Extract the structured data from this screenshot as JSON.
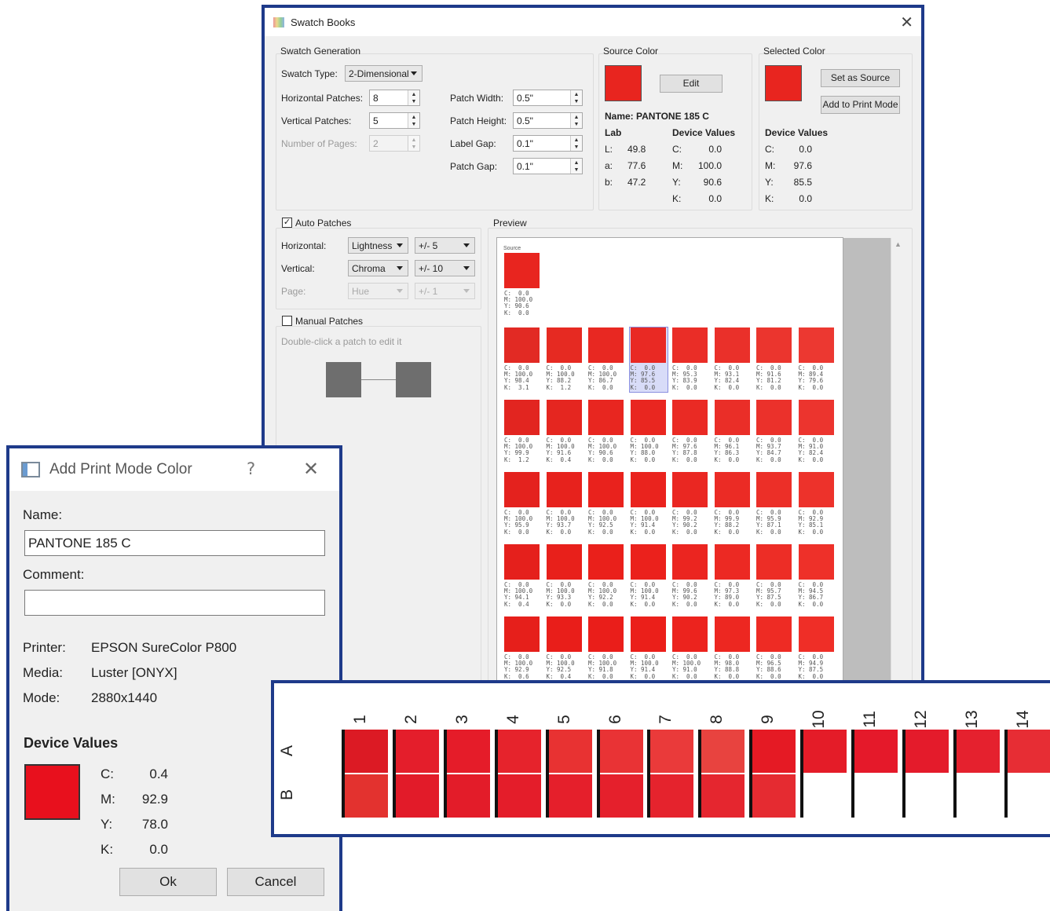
{
  "swatch_window": {
    "title": "Swatch Books",
    "generation": {
      "title": "Swatch Generation",
      "swatch_type_label": "Swatch Type:",
      "swatch_type_value": "2-Dimensional",
      "horizontal_label": "Horizontal Patches:",
      "horizontal_value": "8",
      "vertical_label": "Vertical Patches:",
      "vertical_value": "5",
      "pages_label": "Number of Pages:",
      "pages_value": "2",
      "patch_width_label": "Patch Width:",
      "patch_width_value": "0.5\"",
      "patch_height_label": "Patch Height:",
      "patch_height_value": "0.5\"",
      "label_gap_label": "Label Gap:",
      "label_gap_value": "0.1\"",
      "patch_gap_label": "Patch Gap:",
      "patch_gap_value": "0.1\""
    },
    "source": {
      "title": "Source Color",
      "edit_label": "Edit",
      "name_line": "Name: PANTONE 185 C",
      "lab_header": "Lab",
      "device_header": "Device Values",
      "lab_rows": [
        [
          "L:",
          "49.8"
        ],
        [
          "a:",
          "77.6"
        ],
        [
          "b:",
          "47.2"
        ]
      ],
      "device_rows": [
        [
          "C:",
          "0.0"
        ],
        [
          "M:",
          "100.0"
        ],
        [
          "Y:",
          "90.6"
        ],
        [
          "K:",
          "0.0"
        ]
      ],
      "swatch_color": "#e8251f"
    },
    "selected": {
      "title": "Selected Color",
      "set_source_label": "Set as Source",
      "add_print_label": "Add to Print Mode",
      "device_header": "Device Values",
      "device_rows": [
        [
          "C:",
          "0.0"
        ],
        [
          "M:",
          "97.6"
        ],
        [
          "Y:",
          "85.5"
        ],
        [
          "K:",
          "0.0"
        ]
      ],
      "swatch_color": "#e8251f"
    },
    "auto": {
      "title": "Auto Patches",
      "checked": true,
      "horizontal_label": "Horizontal:",
      "horizontal_mode": "Lightness",
      "horizontal_step": "+/- 5",
      "vertical_label": "Vertical:",
      "vertical_mode": "Chroma",
      "vertical_step": "+/- 10",
      "page_label": "Page:",
      "page_mode": "Hue",
      "page_step": "+/- 1"
    },
    "manual": {
      "title": "Manual Patches",
      "checked": false,
      "hint": "Double-click a patch to edit it"
    },
    "preview": {
      "title": "Preview",
      "source_label": "Source",
      "source_values": "C:  0.0\nM: 100.0\nY: 90.6\nK:  0.0",
      "rows": [
        [
          {
            "c": "#e22a24",
            "t": "C:  0.0\nM: 100.0\nY: 98.4\nK:  3.1"
          },
          {
            "c": "#e62a22",
            "t": "C:  0.0\nM: 100.0\nY: 88.2\nK:  1.2"
          },
          {
            "c": "#e82822",
            "t": "C:  0.0\nM: 100.0\nY: 86.7\nK:  0.0"
          },
          {
            "c": "#e92924",
            "t": "C:  0.0\nM: 97.6\nY: 85.5\nK:  0.0",
            "sel": true
          },
          {
            "c": "#ea2d27",
            "t": "C:  0.0\nM: 95.3\nY: 83.9\nK:  0.0"
          },
          {
            "c": "#ea302a",
            "t": "C:  0.0\nM: 93.1\nY: 82.4\nK:  0.0"
          },
          {
            "c": "#eb352e",
            "t": "C:  0.0\nM: 91.6\nY: 81.2\nK:  0.0"
          },
          {
            "c": "#ec3831",
            "t": "C:  0.0\nM: 89.4\nY: 79.6\nK:  0.0"
          }
        ],
        [
          {
            "c": "#e22520",
            "t": "C:  0.0\nM: 100.0\nY: 99.9\nK:  1.2"
          },
          {
            "c": "#e52620",
            "t": "C:  0.0\nM: 100.0\nY: 91.6\nK:  0.4"
          },
          {
            "c": "#e82620",
            "t": "C:  0.0\nM: 100.0\nY: 90.6\nK:  0.0"
          },
          {
            "c": "#e92620",
            "t": "C:  0.0\nM: 100.0\nY: 88.0\nK:  0.0"
          },
          {
            "c": "#ea2a24",
            "t": "C:  0.0\nM: 97.6\nY: 87.8\nK:  0.0"
          },
          {
            "c": "#ea2e28",
            "t": "C:  0.0\nM: 96.1\nY: 86.3\nK:  0.0"
          },
          {
            "c": "#eb312b",
            "t": "C:  0.0\nM: 93.7\nY: 84.7\nK:  0.0"
          },
          {
            "c": "#ec342e",
            "t": "C:  0.0\nM: 91.0\nY: 82.4\nK:  0.0"
          }
        ],
        [
          {
            "c": "#e4221e",
            "t": "C:  0.0\nM: 100.0\nY: 95.9\nK:  0.0"
          },
          {
            "c": "#e7221d",
            "t": "C:  0.0\nM: 100.0\nY: 93.7\nK:  0.0"
          },
          {
            "c": "#e9221d",
            "t": "C:  0.0\nM: 100.0\nY: 92.5\nK:  0.0"
          },
          {
            "c": "#ea231e",
            "t": "C:  0.0\nM: 100.0\nY: 91.4\nK:  0.0"
          },
          {
            "c": "#ea2722",
            "t": "C:  0.0\nM: 99.2\nY: 90.2\nK:  0.0"
          },
          {
            "c": "#eb2b25",
            "t": "C:  0.0\nM: 99.9\nY: 88.2\nK:  0.0"
          },
          {
            "c": "#ec2f28",
            "t": "C:  0.0\nM: 95.9\nY: 87.1\nK:  0.0"
          },
          {
            "c": "#ed322b",
            "t": "C:  0.0\nM: 92.9\nY: 85.1\nK:  0.0"
          }
        ],
        [
          {
            "c": "#e5201c",
            "t": "C:  0.0\nM: 100.0\nY: 94.1\nK:  0.4"
          },
          {
            "c": "#e8201b",
            "t": "C:  0.0\nM: 100.0\nY: 93.3\nK:  0.0"
          },
          {
            "c": "#ea201b",
            "t": "C:  0.0\nM: 100.0\nY: 92.2\nK:  0.0"
          },
          {
            "c": "#eb211c",
            "t": "C:  0.0\nM: 100.0\nY: 91.4\nK:  0.0"
          },
          {
            "c": "#eb2520",
            "t": "C:  0.0\nM: 99.6\nY: 90.2\nK:  0.0"
          },
          {
            "c": "#ec2923",
            "t": "C:  0.0\nM: 97.3\nY: 89.0\nK:  0.0"
          },
          {
            "c": "#ed2d26",
            "t": "C:  0.0\nM: 95.7\nY: 87.5\nK:  0.0"
          },
          {
            "c": "#ee3029",
            "t": "C:  0.0\nM: 94.5\nY: 86.7\nK:  0.0"
          }
        ],
        [
          {
            "c": "#e61f1b",
            "t": "C:  0.0\nM: 100.0\nY: 92.9\nK:  0.6"
          },
          {
            "c": "#e91e1a",
            "t": "C:  0.0\nM: 100.0\nY: 92.5\nK:  0.4"
          },
          {
            "c": "#ea1e1a",
            "t": "C:  0.0\nM: 100.0\nY: 91.8\nK:  0.0"
          },
          {
            "c": "#eb1f1a",
            "t": "C:  0.0\nM: 100.0\nY: 91.4\nK:  0.0"
          },
          {
            "c": "#ec231e",
            "t": "C:  0.0\nM: 100.0\nY: 91.0\nK:  0.0"
          },
          {
            "c": "#ed2721",
            "t": "C:  0.0\nM: 98.0\nY: 88.8\nK:  0.0"
          },
          {
            "c": "#ee2b24",
            "t": "C:  0.0\nM: 96.5\nY: 88.6\nK:  0.0"
          },
          {
            "c": "#ef2e27",
            "t": "C:  0.0\nM: 94.9\nY: 87.5\nK:  0.0"
          }
        ]
      ]
    }
  },
  "print_mode_dialog": {
    "title": "Add Print Mode Color",
    "help_glyph": "?",
    "name_label": "Name:",
    "name_value": "PANTONE 185 C",
    "comment_label": "Comment:",
    "comment_value": "",
    "printer_label": "Printer:",
    "printer_value": "EPSON SureColor P800",
    "media_label": "Media:",
    "media_value": "Luster [ONYX]",
    "mode_label": "Mode:",
    "mode_value": "2880x1440",
    "device_header": "Device Values",
    "device_rows": [
      [
        "C:",
        "0.4"
      ],
      [
        "M:",
        "92.9"
      ],
      [
        "Y:",
        "78.0"
      ],
      [
        "K:",
        "0.0"
      ]
    ],
    "swatch_color": "#e8101d",
    "ok_label": "Ok",
    "cancel_label": "Cancel"
  },
  "target_strip": {
    "row_labels": [
      "A",
      "B"
    ],
    "column_numbers": [
      "1",
      "2",
      "3",
      "4",
      "5",
      "6",
      "7",
      "8",
      "9",
      "10",
      "11",
      "12",
      "13",
      "14"
    ],
    "row_a_colors": [
      "#dc1a24",
      "#e41e2b",
      "#e51c29",
      "#e6232c",
      "#e83232",
      "#e93335",
      "#ea3a3a",
      "#e8433f",
      "#e51a24",
      "#e41c28",
      "#e5192a",
      "#e41b2b",
      "#e5212e",
      "#e72d34"
    ],
    "row_b_colors": [
      "#e3322f",
      "#e21b29",
      "#e31c29",
      "#e41d2a",
      "#e51f2b",
      "#e5202c",
      "#e5232d",
      "#e5262f",
      "#e52b31"
    ]
  }
}
